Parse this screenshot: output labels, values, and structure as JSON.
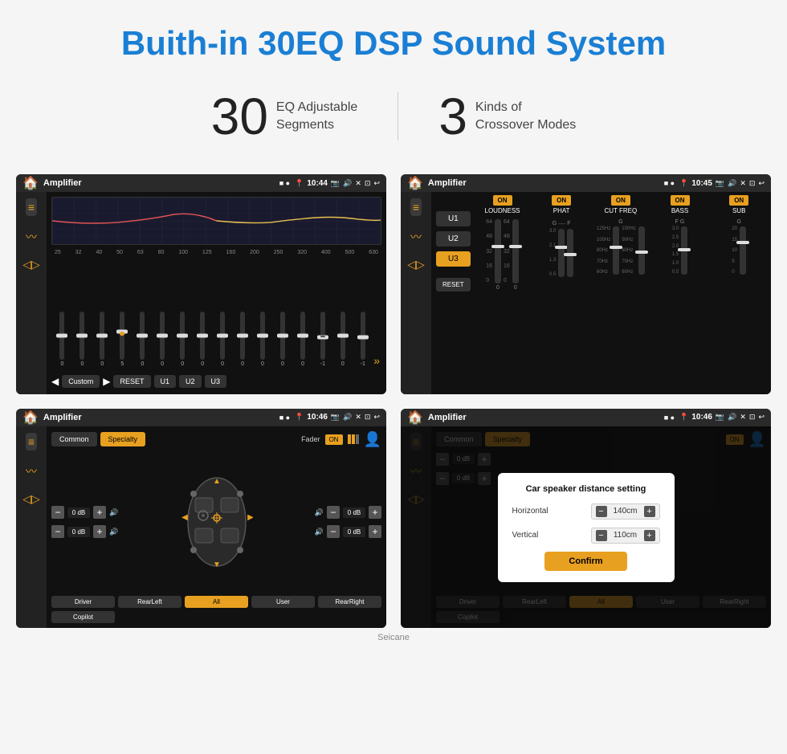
{
  "header": {
    "title": "Buith-in 30EQ DSP Sound System"
  },
  "stats": [
    {
      "number": "30",
      "label": "EQ Adjustable\nSegments"
    },
    {
      "number": "3",
      "label": "Kinds of\nCrossover Modes"
    }
  ],
  "screens": {
    "screen1": {
      "title": "Amplifier",
      "time": "10:44",
      "frequencies": [
        "25",
        "32",
        "40",
        "50",
        "63",
        "80",
        "100",
        "125",
        "160",
        "200",
        "250",
        "320",
        "400",
        "500",
        "630"
      ],
      "sliders": [
        {
          "value": "0"
        },
        {
          "value": "0"
        },
        {
          "value": "0"
        },
        {
          "value": "5"
        },
        {
          "value": "0"
        },
        {
          "value": "0"
        },
        {
          "value": "0"
        },
        {
          "value": "0"
        },
        {
          "value": "0"
        },
        {
          "value": "0"
        },
        {
          "value": "0"
        },
        {
          "value": "0"
        },
        {
          "value": "0"
        },
        {
          "value": "-1"
        },
        {
          "value": "0"
        },
        {
          "value": "-1"
        }
      ],
      "preset": "Custom",
      "buttons": [
        "RESET",
        "U1",
        "U2",
        "U3"
      ]
    },
    "screen2": {
      "title": "Amplifier",
      "time": "10:45",
      "presets": [
        "U1",
        "U2",
        "U3"
      ],
      "active_preset": "U3",
      "bands": [
        "LOUDNESS",
        "PHAT",
        "CUT FREQ",
        "BASS",
        "SUB"
      ],
      "reset_label": "RESET"
    },
    "screen3": {
      "title": "Amplifier",
      "time": "10:46",
      "tabs": [
        "Common",
        "Specialty"
      ],
      "active_tab": "Specialty",
      "fader_label": "Fader",
      "fader_on": "ON",
      "speaker_positions": [
        "Driver",
        "RearLeft",
        "All",
        "User",
        "RearRight",
        "Copilot"
      ],
      "db_values": [
        "0 dB",
        "0 dB",
        "0 dB",
        "0 dB"
      ],
      "active_position": "All"
    },
    "screen4": {
      "title": "Amplifier",
      "time": "10:46",
      "dialog": {
        "title": "Car speaker distance setting",
        "horizontal_label": "Horizontal",
        "horizontal_value": "140cm",
        "vertical_label": "Vertical",
        "vertical_value": "110cm",
        "confirm_label": "Confirm"
      },
      "tabs": [
        "Common",
        "Specialty"
      ],
      "active_tab": "Specialty"
    }
  },
  "watermark": "Seicane"
}
